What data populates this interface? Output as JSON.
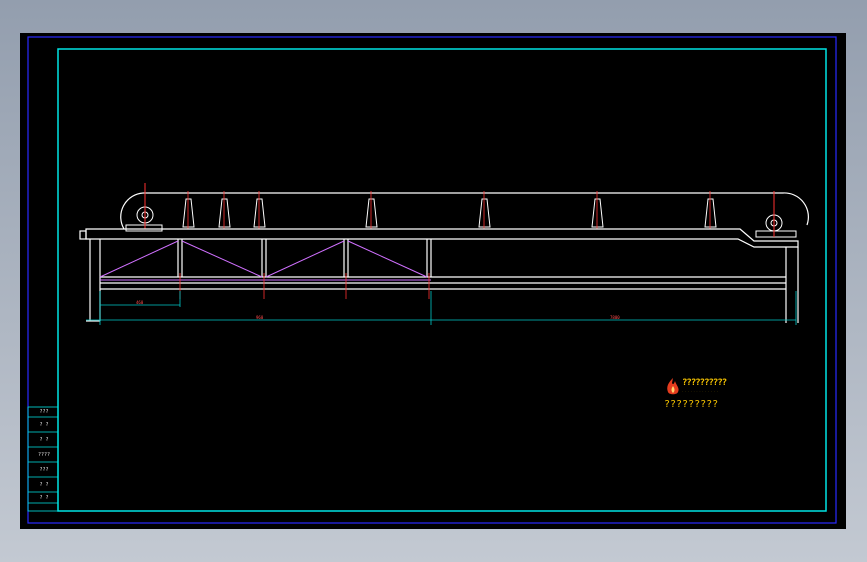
{
  "drawing": {
    "background": "#000000",
    "colors": {
      "frame_outer": "#2a2aff",
      "frame_inner": "#00e5e5",
      "structure": "#ffffff",
      "bracing": "#d070ff",
      "dimension": "#00c8c8",
      "center_mark": "#ff3030",
      "logo": "#f7c400",
      "logo_emblem": "#e43c1e"
    },
    "dimensions": [
      {
        "label": "460"
      },
      {
        "label": "960"
      },
      {
        "label": "7800"
      }
    ],
    "logo": {
      "main_text": "??????????",
      "sub_text": "· · · · · · · · · · · · ·",
      "bottom_text": "?????????"
    },
    "revision_table": [
      {
        "text": "???"
      },
      {
        "text": "? ?"
      },
      {
        "text": "? ?"
      },
      {
        "text": "????"
      },
      {
        "text": "???"
      },
      {
        "text": "? ?"
      },
      {
        "text": "? ?"
      }
    ]
  }
}
